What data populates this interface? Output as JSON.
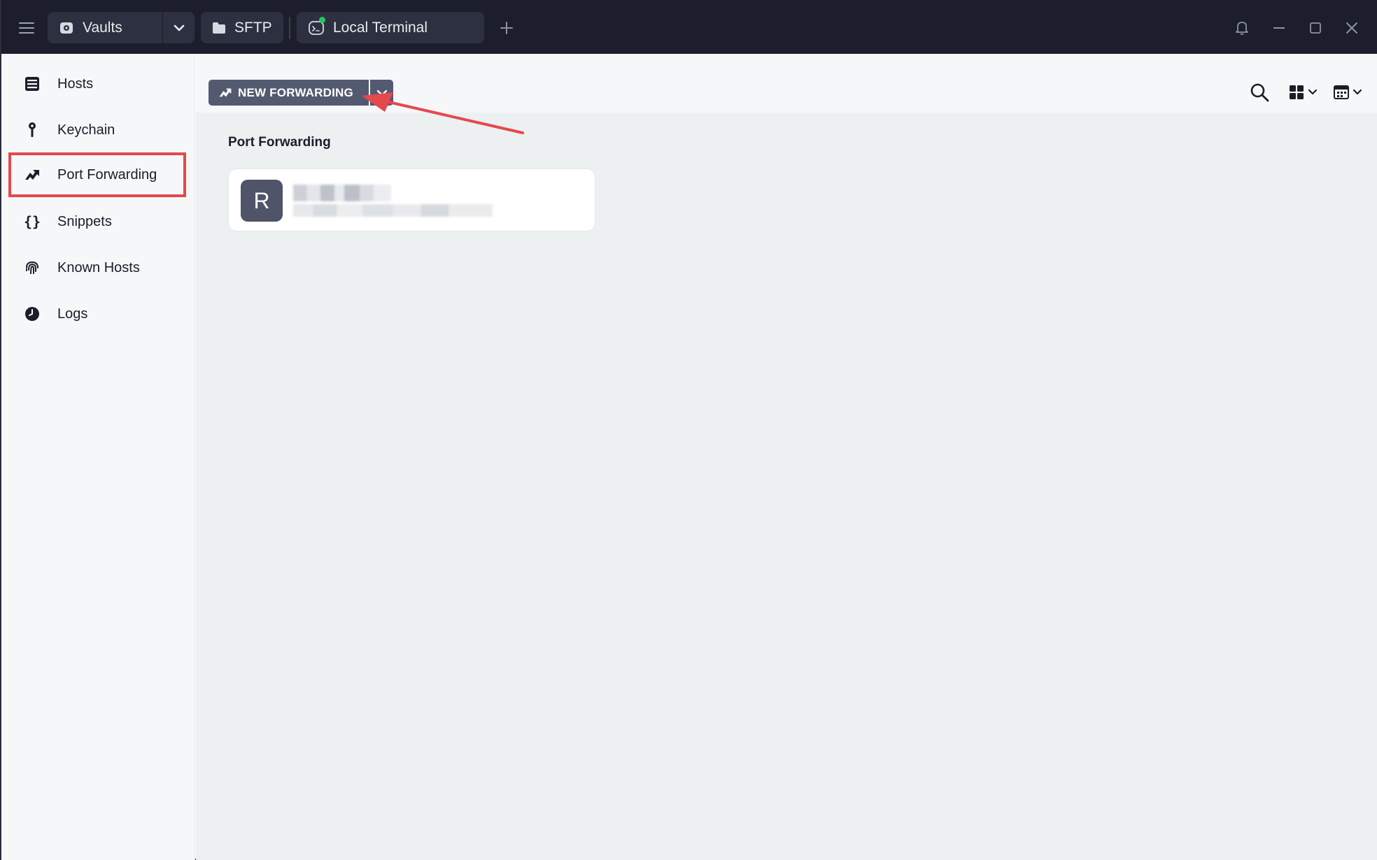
{
  "titlebar": {
    "tabs": [
      {
        "label": "Vaults",
        "icon": "vault-icon"
      },
      {
        "label": "SFTP",
        "icon": "folder-icon"
      },
      {
        "label": "Local Terminal",
        "icon": "terminal-icon",
        "status_color": "#22c55e"
      }
    ]
  },
  "sidebar": {
    "items": [
      {
        "label": "Hosts",
        "icon": "hosts-icon",
        "active": false
      },
      {
        "label": "Keychain",
        "icon": "key-icon",
        "active": false
      },
      {
        "label": "Port Forwarding",
        "icon": "port-forwarding-icon",
        "active": true
      },
      {
        "label": "Snippets",
        "icon": "braces-icon",
        "active": false
      },
      {
        "label": "Known Hosts",
        "icon": "fingerprint-icon",
        "active": false
      },
      {
        "label": "Logs",
        "icon": "clock-icon",
        "active": false
      }
    ]
  },
  "toolbar": {
    "new_forwarding_label": "NEW FORWARDING"
  },
  "main": {
    "section_title": "Port Forwarding",
    "rules": [
      {
        "avatar_letter": "R"
      }
    ]
  },
  "colors": {
    "titlebar_bg": "#1c1e2b",
    "tab_bg": "#2d3040",
    "button_bg": "#535a70",
    "highlight": "#e5484d",
    "content_bg": "#ecf0f1"
  }
}
